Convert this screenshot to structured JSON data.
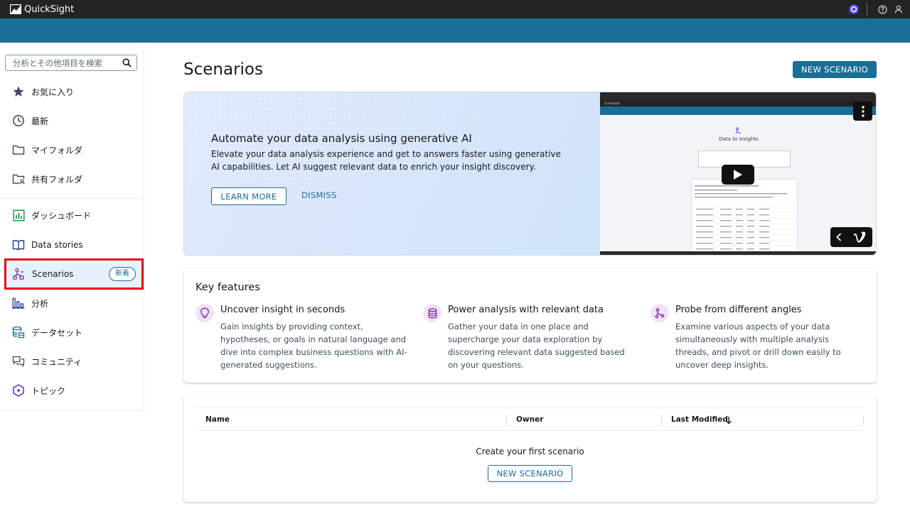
{
  "app": {
    "name": "QuickSight"
  },
  "colors": {
    "accent": "#1a6e96",
    "topbar": "#232323",
    "active_bg": "#e6f2fb",
    "highlight": "#e8001c",
    "feature_icon_bg": "#f1e3f6",
    "feature_icon": "#7b2b9b"
  },
  "sidebar": {
    "search_placeholder": "分析とその他項目を検索",
    "items": [
      {
        "label": "お気に入り",
        "icon": "star-icon"
      },
      {
        "label": "最新",
        "icon": "clock-icon"
      },
      {
        "label": "マイフォルダ",
        "icon": "folder-icon"
      },
      {
        "label": "共有フォルダ",
        "icon": "shared-folder-icon"
      },
      {
        "label": "ダッシュボード",
        "icon": "dashboard-icon"
      },
      {
        "label": "Data stories",
        "icon": "book-icon"
      },
      {
        "label": "Scenarios",
        "icon": "scenarios-icon",
        "badge": "新着",
        "active": true
      },
      {
        "label": "分析",
        "icon": "bar-chart-icon"
      },
      {
        "label": "データセット",
        "icon": "dataset-icon"
      },
      {
        "label": "コミュニティ",
        "icon": "chat-icon"
      },
      {
        "label": "トピック",
        "icon": "topic-icon"
      }
    ]
  },
  "main": {
    "title": "Scenarios",
    "new_button": "NEW SCENARIO",
    "hero": {
      "title": "Automate your data analysis using generative AI",
      "desc": "Elevate your data analysis experience and get to answers faster using generative AI capabilities. Let AI suggest relevant data to enrich your insight discovery.",
      "learn_more": "LEARN MORE",
      "dismiss": "DISMISS",
      "video": {
        "window_title": "QuickSight",
        "screen_title": "Data to insights"
      }
    },
    "key_features": {
      "title": "Key features",
      "items": [
        {
          "title": "Uncover insight in seconds",
          "desc": "Gain insights by providing context, hypotheses, or goals in natural language and dive into complex business questions with AI-generated suggestions.",
          "icon": "lightbulb-icon"
        },
        {
          "title": "Power analysis with relevant data",
          "desc": "Gather your data in one place and supercharge your data exploration by discovering relevant data suggested based on your questions.",
          "icon": "database-icon"
        },
        {
          "title": "Probe from different angles",
          "desc": "Examine various aspects of your data simultaneously with multiple analysis threads, and pivot or drill down easily to uncover deep insights.",
          "icon": "branch-icon"
        }
      ]
    },
    "table": {
      "columns": [
        "Name",
        "Owner",
        "Last Modified"
      ],
      "empty_text": "Create your first scenario",
      "empty_button": "NEW SCENARIO"
    }
  }
}
